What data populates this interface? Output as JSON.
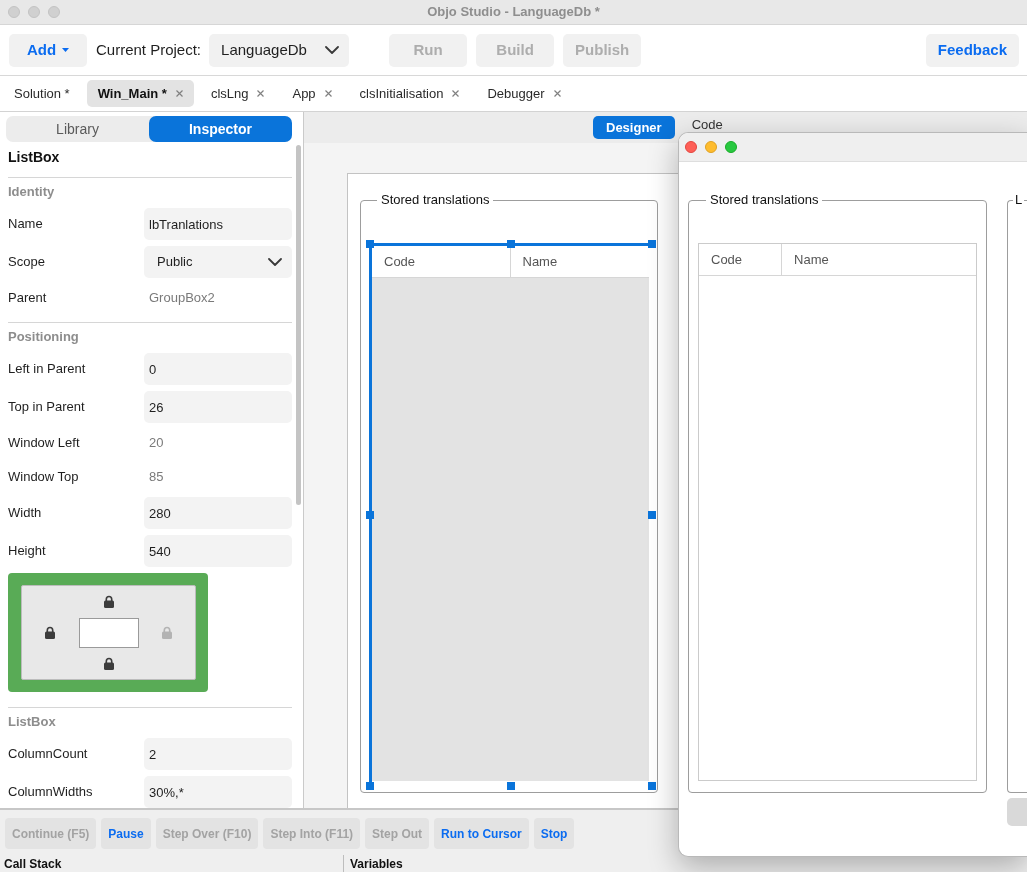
{
  "window": {
    "title": "Objo Studio - LanguageDb *"
  },
  "toolbar": {
    "add_button": "Add",
    "project_label": "Current Project:",
    "project": "LanguageDb",
    "actions": [
      {
        "label": "Run",
        "disabled": true
      },
      {
        "label": "Build",
        "disabled": true
      },
      {
        "label": "Publish",
        "disabled": true
      }
    ],
    "feedback_button": "Feedback"
  },
  "tabs": [
    {
      "label": "Solution *",
      "selected": false,
      "closable": false
    },
    {
      "label": "Win_Main *",
      "selected": true,
      "closable": true
    },
    {
      "label": "clsLng",
      "selected": false,
      "closable": true
    },
    {
      "label": "App",
      "selected": false,
      "closable": true
    },
    {
      "label": "clsInitialisation",
      "selected": false,
      "closable": true
    },
    {
      "label": "Debugger",
      "selected": false,
      "closable": true
    }
  ],
  "sidebar": {
    "segments": [
      {
        "label": "Library",
        "selected": false
      },
      {
        "label": "Inspector",
        "selected": true
      }
    ],
    "heading": "ListBox",
    "sections": [
      {
        "title": "Identity",
        "items": [
          {
            "kind": "text",
            "label": "Name",
            "value": "lbTranlations"
          },
          {
            "kind": "select",
            "label": "Scope",
            "value": "Public"
          },
          {
            "kind": "readonly",
            "label": "Parent",
            "value": "GroupBox2"
          }
        ]
      },
      {
        "title": "Positioning",
        "items": [
          {
            "kind": "text",
            "label": "Left in Parent",
            "value": "0"
          },
          {
            "kind": "text",
            "label": "Top in Parent",
            "value": "26"
          },
          {
            "kind": "readonly",
            "label": "Window Left",
            "value": "20"
          },
          {
            "kind": "readonly",
            "label": "Window Top",
            "value": "85"
          },
          {
            "kind": "text",
            "label": "Width",
            "value": "280"
          },
          {
            "kind": "text",
            "label": "Height",
            "value": "540"
          },
          {
            "kind": "anchors",
            "top": true,
            "left": true,
            "right": false,
            "bottom": true
          }
        ]
      },
      {
        "title": "ListBox",
        "items": [
          {
            "kind": "text",
            "label": "ColumnCount",
            "value": "2"
          },
          {
            "kind": "text",
            "label": "ColumnWidths",
            "value": "30%,*"
          }
        ]
      }
    ]
  },
  "designer": {
    "views": [
      {
        "label": "Designer",
        "selected": true
      },
      {
        "label": "Code",
        "selected": false
      }
    ],
    "groupbox": {
      "title": "Stored translations",
      "listbox": {
        "selected": true,
        "columns": [
          "Code",
          "Name"
        ]
      }
    }
  },
  "preview_window": {
    "groupboxes": [
      {
        "title": "Stored translations",
        "columns": [
          "Code",
          "Name"
        ]
      },
      {
        "title": "L"
      }
    ]
  },
  "debug_bar": {
    "buttons": [
      {
        "label": "Continue (F5)",
        "disabled": true
      },
      {
        "label": "Pause",
        "disabled": false
      },
      {
        "label": "Step Over (F10)",
        "disabled": true
      },
      {
        "label": "Step Into (F11)",
        "disabled": true
      },
      {
        "label": "Step Out",
        "disabled": true
      },
      {
        "label": "Run to Cursor",
        "disabled": false
      },
      {
        "label": "Stop",
        "disabled": false
      }
    ],
    "panels": [
      "Call Stack",
      "Variables"
    ]
  }
}
